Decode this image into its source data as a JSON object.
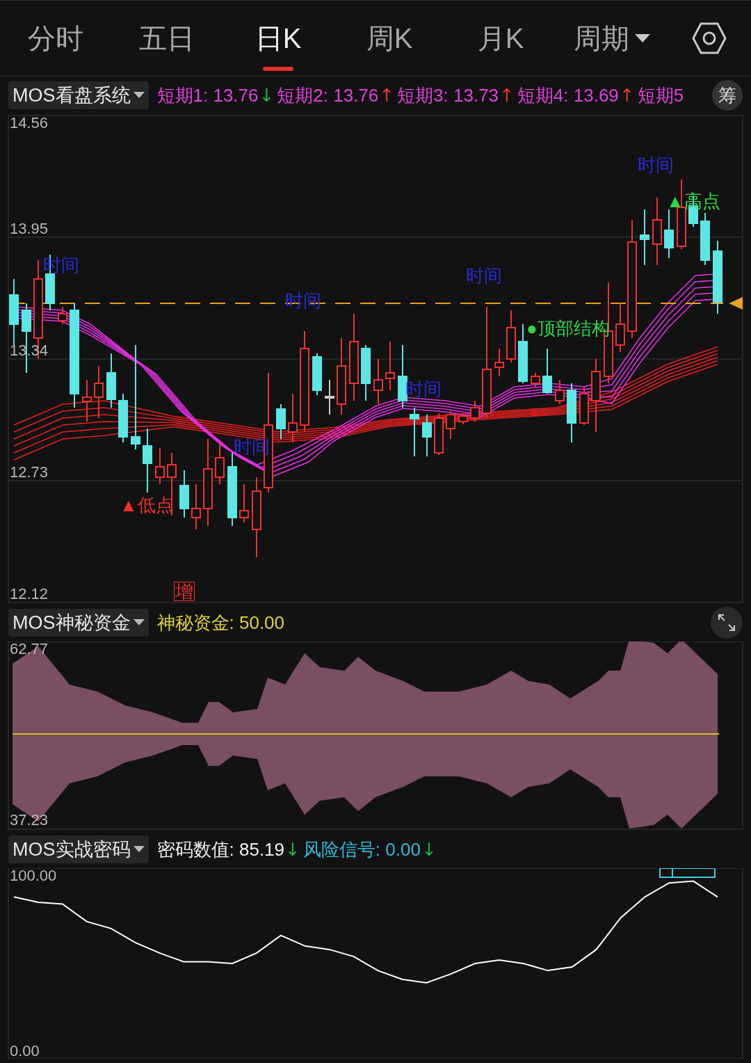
{
  "period_tabs": [
    {
      "label": "分时",
      "selected": false,
      "kind": "tab"
    },
    {
      "label": "五日",
      "selected": false,
      "kind": "tab"
    },
    {
      "label": "日K",
      "selected": true,
      "kind": "tab"
    },
    {
      "label": "周K",
      "selected": false,
      "kind": "tab"
    },
    {
      "label": "月K",
      "selected": false,
      "kind": "tab"
    },
    {
      "label": "周期",
      "selected": false,
      "kind": "dropdown"
    }
  ],
  "main_panel": {
    "indicator": "MOS看盘系统",
    "readings": [
      {
        "label": "短期1:",
        "value": "13.76",
        "arrow": {
          "text": "↓",
          "color": "#1fae4a"
        },
        "color": "#e040e0"
      },
      {
        "label": "短期2:",
        "value": "13.76",
        "arrow": {
          "text": "↑",
          "color": "#e5392e"
        },
        "color": "#e040e0"
      },
      {
        "label": "短期3:",
        "value": "13.73",
        "arrow": {
          "text": "↑",
          "color": "#e5392e"
        },
        "color": "#e040e0"
      },
      {
        "label": "短期4:",
        "value": "13.69",
        "arrow": {
          "text": "↑",
          "color": "#e5392e"
        },
        "color": "#e040e0"
      },
      {
        "label": "短期5",
        "color": "#e040e0"
      }
    ],
    "side_button": "筹",
    "price_labels": [
      "14.56",
      "13.95",
      "13.34",
      "12.73",
      "12.12"
    ],
    "annotations": [
      {
        "text": "时间",
        "kind": "time"
      },
      {
        "text": "时间",
        "kind": "time"
      },
      {
        "text": "时间",
        "kind": "time"
      },
      {
        "text": "时间",
        "kind": "time"
      },
      {
        "text": "时间",
        "kind": "time"
      },
      {
        "text": "时间",
        "kind": "time"
      },
      {
        "text": "▲低点",
        "kind": "low"
      },
      {
        "text": "▲高点",
        "kind": "high"
      },
      {
        "text": "●顶部结构",
        "kind": "top"
      },
      {
        "text": "增",
        "kind": "tag"
      }
    ]
  },
  "fund_panel": {
    "indicator": "MOS神秘资金",
    "readings": [
      {
        "label": "神秘资金:",
        "value": "50.00",
        "color": "#e0d23a"
      }
    ],
    "axis_labels": [
      "62.77",
      "37.23"
    ]
  },
  "code_panel": {
    "indicator": "MOS实战密码",
    "readings": [
      {
        "label": "密码数值:",
        "value": "85.19",
        "arrow": {
          "text": "↓",
          "color": "#1fae4a"
        },
        "color": "#f0f0f0"
      },
      {
        "label": "风险信号:",
        "value": "0.00",
        "arrow": {
          "text": "↓",
          "color": "#1fae4a"
        },
        "color": "#35b8d8"
      }
    ],
    "chart_data": {
      "type": "line",
      "ylim": [
        -4.4,
        104.4
      ],
      "yticks": [
        {
          "value": 100,
          "label": "100.00"
        },
        {
          "value": 0,
          "label": "0.00"
        }
      ],
      "series": [
        {
          "color": "#ffffff",
          "values": [
            88,
            85,
            84,
            74,
            70,
            62,
            56,
            51,
            51,
            50,
            56,
            66,
            60,
            58,
            54,
            46,
            41,
            39,
            44,
            50,
            52,
            50,
            46,
            48,
            58,
            76,
            88,
            96,
            97,
            88
          ]
        }
      ]
    }
  }
}
